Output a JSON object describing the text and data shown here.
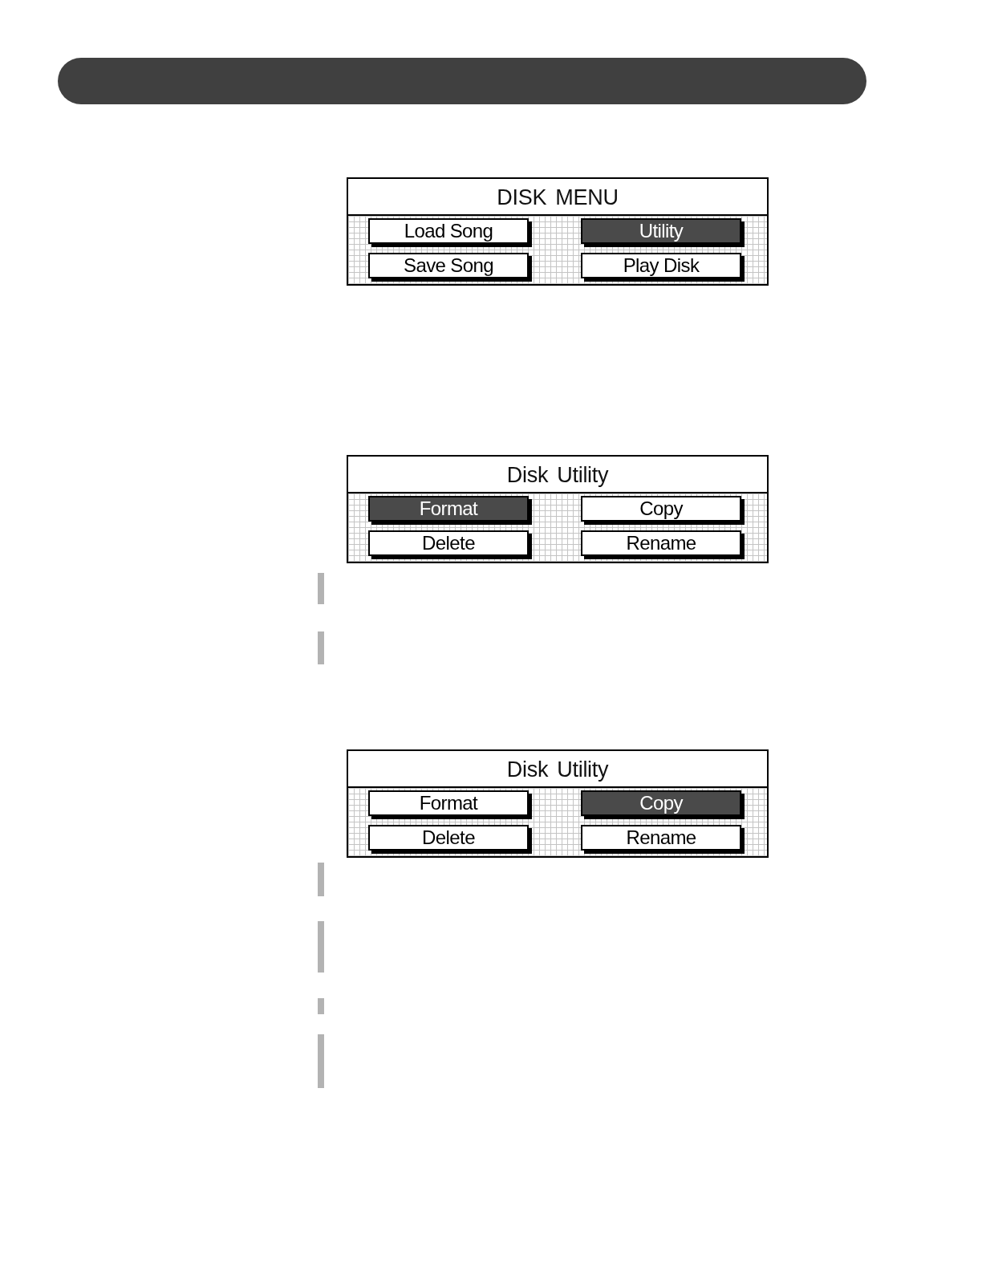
{
  "screens": [
    {
      "title": "DISK MENU",
      "buttons": [
        {
          "label": "Load Song",
          "selected": false
        },
        {
          "label": "Utility",
          "selected": true
        },
        {
          "label": "Save Song",
          "selected": false
        },
        {
          "label": "Play Disk",
          "selected": false
        }
      ]
    },
    {
      "title": "Disk Utility",
      "buttons": [
        {
          "label": "Format",
          "selected": true
        },
        {
          "label": "Copy",
          "selected": false
        },
        {
          "label": "Delete",
          "selected": false
        },
        {
          "label": "Rename",
          "selected": false
        }
      ]
    },
    {
      "title": "Disk Utility",
      "buttons": [
        {
          "label": "Format",
          "selected": false
        },
        {
          "label": "Copy",
          "selected": true
        },
        {
          "label": "Delete",
          "selected": false
        },
        {
          "label": "Rename",
          "selected": false
        }
      ]
    }
  ]
}
